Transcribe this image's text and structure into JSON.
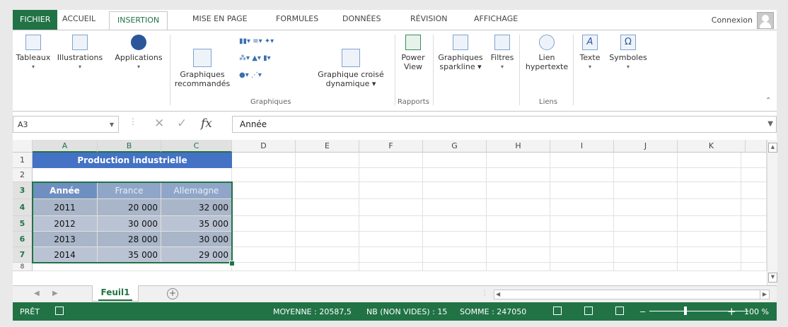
{
  "tabs": [
    "FICHIER",
    "ACCUEIL",
    "INSERTION",
    "MISE EN PAGE",
    "FORMULES",
    "DONNÉES",
    "RÉVISION",
    "AFFICHAGE"
  ],
  "active_tab": "INSERTION",
  "account": "Connexion",
  "ribbon": {
    "tableaux": "Tableaux",
    "illustrations": "Illustrations",
    "applications": "Applications",
    "graph_recommandes_1": "Graphiques",
    "graph_recommandes_2": "recommandés",
    "graph_croise_1": "Graphique croisé",
    "graph_croise_2": "dynamique ▾",
    "power_1": "Power",
    "power_2": "View",
    "sparkline_1": "Graphiques",
    "sparkline_2": "sparkline ▾",
    "filtres": "Filtres",
    "lien_1": "Lien",
    "lien_2": "hypertexte",
    "texte": "Texte",
    "symboles": "Symboles",
    "group_graphiques": "Graphiques",
    "group_rapports": "Rapports",
    "group_liens": "Liens"
  },
  "formula_bar": {
    "name_box": "A3",
    "fx": "fx",
    "content": "Année"
  },
  "columns": [
    "A",
    "B",
    "C",
    "D",
    "E",
    "F",
    "G",
    "H",
    "I",
    "J",
    "K"
  ],
  "rows": [
    "1",
    "2",
    "3",
    "4",
    "5",
    "6",
    "7",
    "8"
  ],
  "sheet": {
    "title": "Production industrielle",
    "headers": [
      "Année",
      "France",
      "Allemagne"
    ],
    "data": [
      [
        "2011",
        "20 000",
        "32 000"
      ],
      [
        "2012",
        "30 000",
        "35 000"
      ],
      [
        "2013",
        "28 000",
        "30 000"
      ],
      [
        "2014",
        "35 000",
        "29 000"
      ]
    ]
  },
  "sheet_tab": "Feuil1",
  "status": {
    "ready": "PRÊT",
    "average": "MOYENNE : 20587,5",
    "count": "NB (NON VIDES) : 15",
    "sum": "SOMME : 247050",
    "zoom": "100 %"
  }
}
